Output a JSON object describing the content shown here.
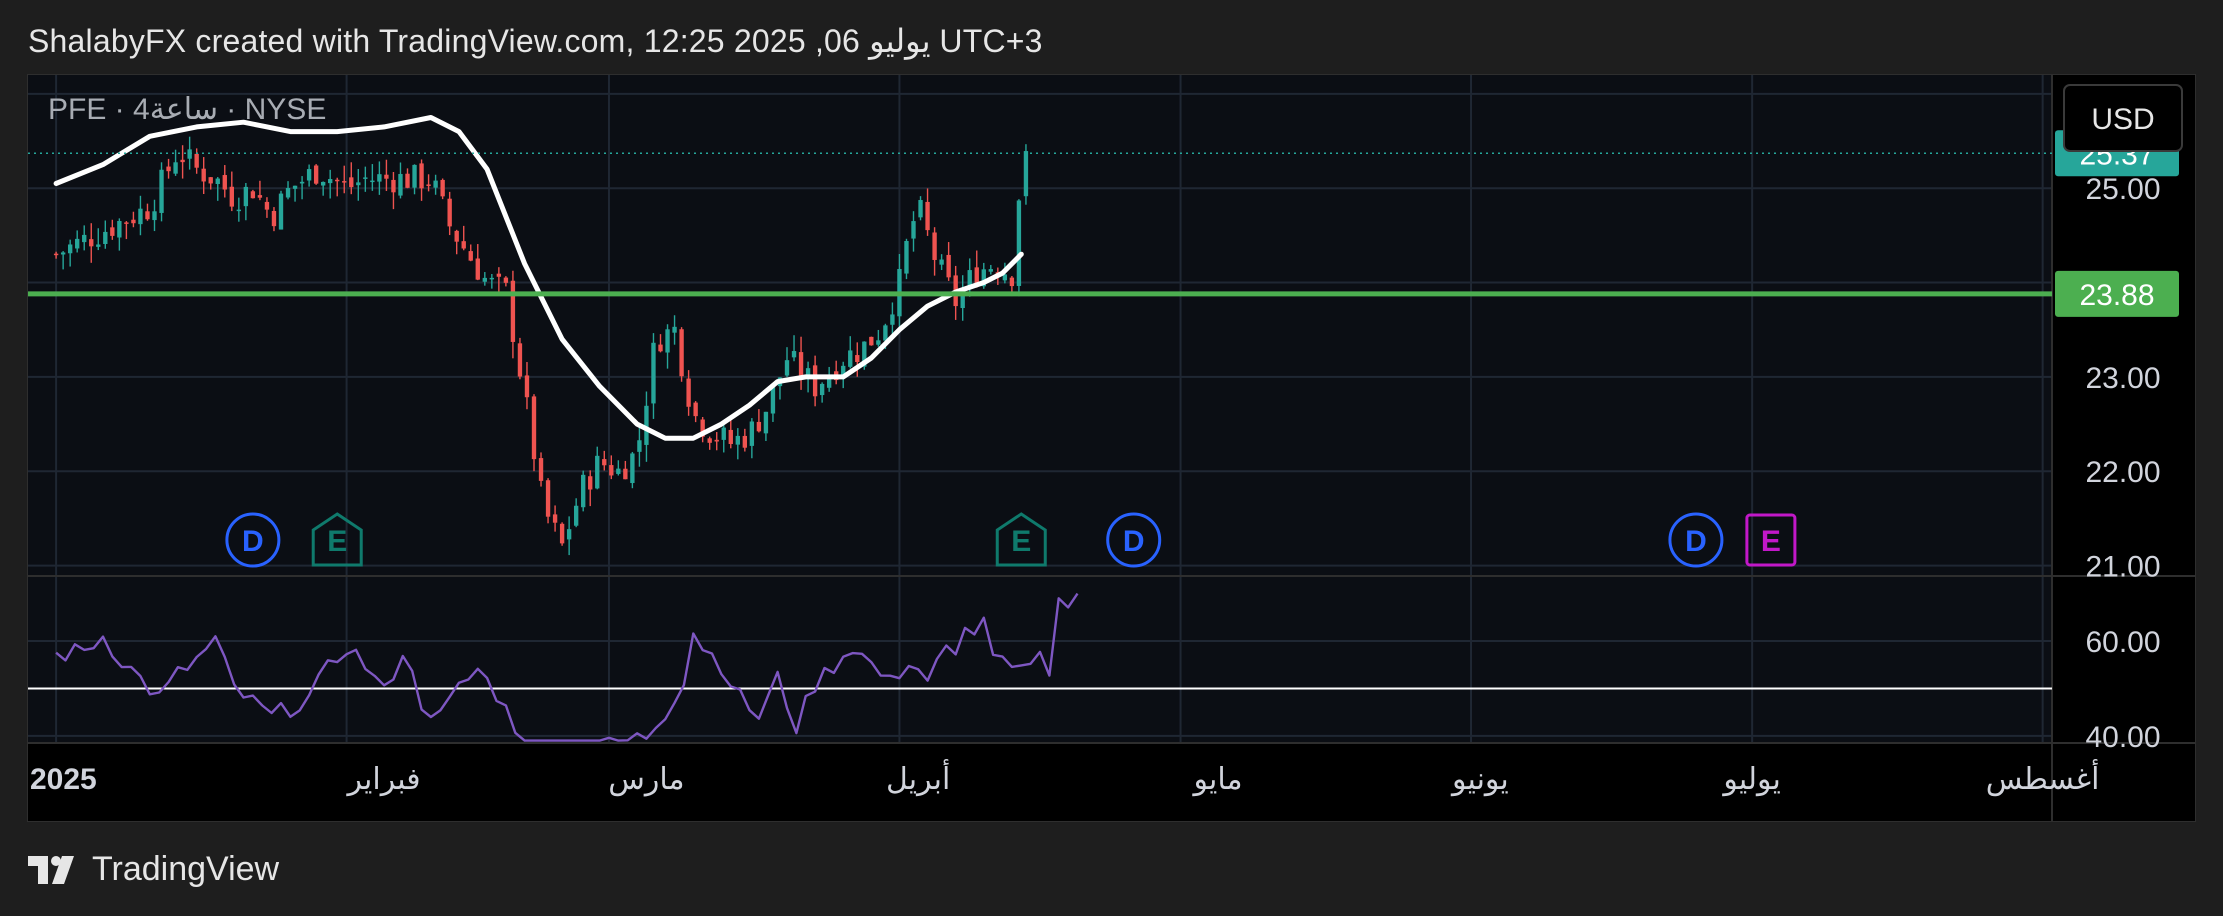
{
  "header": {
    "title": "ShalabyFX created with TradingView.com, 12:25 2025 ,06 يوليو UTC+3"
  },
  "footer": {
    "brand": "TradingView",
    "logo_icon": "tradingview-logo-icon"
  },
  "chart_data": {
    "type": "candlestick",
    "symbol_legend": "PFE · 4ساعة · NYSE",
    "currency": "USD",
    "price_axis": {
      "ticks": [
        "25.00",
        "23.00",
        "22.00",
        "21.00"
      ],
      "range": [
        20.9,
        26.2
      ]
    },
    "last_price": {
      "label": "25.37",
      "value": 25.37,
      "color": "#26a69a"
    },
    "support_line": {
      "label": "23.88",
      "value": 23.88,
      "color": "#4caf50"
    },
    "time_axis": {
      "labels": [
        "2025",
        "فبراير",
        "مارس",
        "أبريل",
        "مايو",
        "يونيو",
        "يوليو",
        "أغسطس"
      ]
    },
    "price_path": [
      [
        0,
        24.3
      ],
      [
        6,
        24.6
      ],
      [
        10,
        24.8
      ],
      [
        13,
        25.4
      ],
      [
        15,
        25.2
      ],
      [
        17,
        25.1
      ],
      [
        19,
        24.9
      ],
      [
        21,
        25.0
      ],
      [
        23,
        24.7
      ],
      [
        25,
        25.0
      ],
      [
        28,
        25.2
      ],
      [
        31,
        25.0
      ],
      [
        33,
        25.1
      ],
      [
        37,
        25.1
      ],
      [
        40,
        25.1
      ],
      [
        42,
        24.6
      ],
      [
        44,
        24.3
      ],
      [
        46,
        24.0
      ],
      [
        48,
        23.9
      ],
      [
        50,
        22.8
      ],
      [
        52,
        21.6
      ],
      [
        54,
        21.2
      ],
      [
        56,
        21.8
      ],
      [
        58,
        22.1
      ],
      [
        60,
        22.0
      ],
      [
        62,
        22.2
      ],
      [
        64,
        23.4
      ],
      [
        66,
        23.5
      ],
      [
        68,
        22.6
      ],
      [
        70,
        22.4
      ],
      [
        72,
        22.3
      ],
      [
        74,
        22.4
      ],
      [
        76,
        22.7
      ],
      [
        78,
        23.2
      ],
      [
        81,
        22.9
      ],
      [
        84,
        23.2
      ],
      [
        86,
        23.3
      ],
      [
        88,
        23.5
      ],
      [
        90,
        24.0
      ],
      [
        91,
        24.5
      ],
      [
        92,
        24.8
      ],
      [
        94,
        24.2
      ],
      [
        96,
        23.8
      ],
      [
        98,
        24.1
      ],
      [
        100,
        24.2
      ],
      [
        102,
        24.1
      ],
      [
        103,
        25.2
      ],
      [
        104,
        25.37
      ]
    ],
    "ma_path": [
      [
        0,
        25.05
      ],
      [
        5,
        25.25
      ],
      [
        10,
        25.55
      ],
      [
        15,
        25.65
      ],
      [
        20,
        25.7
      ],
      [
        25,
        25.6
      ],
      [
        30,
        25.6
      ],
      [
        35,
        25.65
      ],
      [
        40,
        25.75
      ],
      [
        43,
        25.6
      ],
      [
        46,
        25.2
      ],
      [
        50,
        24.2
      ],
      [
        54,
        23.4
      ],
      [
        58,
        22.9
      ],
      [
        62,
        22.5
      ],
      [
        65,
        22.35
      ],
      [
        68,
        22.35
      ],
      [
        71,
        22.5
      ],
      [
        74,
        22.7
      ],
      [
        77,
        22.95
      ],
      [
        80,
        23.0
      ],
      [
        84,
        23.0
      ],
      [
        87,
        23.2
      ],
      [
        90,
        23.5
      ],
      [
        93,
        23.75
      ],
      [
        96,
        23.9
      ],
      [
        99,
        24.0
      ],
      [
        101,
        24.1
      ],
      [
        103,
        24.3
      ]
    ],
    "rsi": {
      "ticks": [
        "60.00",
        "40.00"
      ],
      "range": [
        38.5,
        73.5
      ],
      "midline": 50,
      "color": "#7e57c2",
      "path": [
        [
          0,
          57
        ],
        [
          3,
          58
        ],
        [
          5,
          61
        ],
        [
          7,
          56
        ],
        [
          9,
          52
        ],
        [
          11,
          48
        ],
        [
          13,
          53
        ],
        [
          15,
          56
        ],
        [
          17,
          60
        ],
        [
          19,
          50
        ],
        [
          21,
          47
        ],
        [
          23,
          44
        ],
        [
          25,
          46
        ],
        [
          27,
          48
        ],
        [
          29,
          54
        ],
        [
          31,
          59
        ],
        [
          33,
          55
        ],
        [
          35,
          49
        ],
        [
          37,
          58
        ],
        [
          39,
          47
        ],
        [
          41,
          44
        ],
        [
          43,
          50
        ],
        [
          45,
          54
        ],
        [
          47,
          49
        ],
        [
          49,
          42
        ],
        [
          51,
          37
        ],
        [
          53,
          35
        ],
        [
          55,
          33
        ],
        [
          57,
          36
        ],
        [
          59,
          38
        ],
        [
          61,
          39
        ],
        [
          63,
          40
        ],
        [
          65,
          45
        ],
        [
          67,
          52
        ],
        [
          68,
          62
        ],
        [
          69,
          59
        ],
        [
          71,
          55
        ],
        [
          73,
          48
        ],
        [
          75,
          44
        ],
        [
          77,
          52
        ],
        [
          79,
          42
        ],
        [
          81,
          51
        ],
        [
          83,
          55
        ],
        [
          85,
          59
        ],
        [
          87,
          55
        ],
        [
          89,
          51
        ],
        [
          91,
          56
        ],
        [
          93,
          52
        ],
        [
          95,
          58
        ],
        [
          96,
          56
        ],
        [
          97,
          62
        ],
        [
          99,
          64
        ],
        [
          100,
          58
        ],
        [
          101,
          55
        ],
        [
          103,
          53
        ],
        [
          105,
          56
        ],
        [
          106,
          54
        ],
        [
          107,
          68
        ],
        [
          109,
          70
        ]
      ]
    },
    "event_markers": [
      {
        "label": "D",
        "color": "#2962ff",
        "type": "dividend"
      },
      {
        "label": "E",
        "color": "#0f7a6c",
        "type": "earnings"
      },
      {
        "label": "E",
        "color": "#0f7a6c",
        "type": "earnings"
      },
      {
        "label": "D",
        "color": "#2962ff",
        "type": "dividend"
      },
      {
        "label": "D",
        "color": "#2962ff",
        "type": "dividend"
      },
      {
        "label": "E",
        "color": "#c218c9",
        "type": "earnings-upcoming"
      }
    ],
    "colors": {
      "up": "#26a69a",
      "down": "#ef5350",
      "ma": "#ffffff",
      "grid": "#1f2733",
      "axis_text": "#d1d4dc"
    }
  }
}
